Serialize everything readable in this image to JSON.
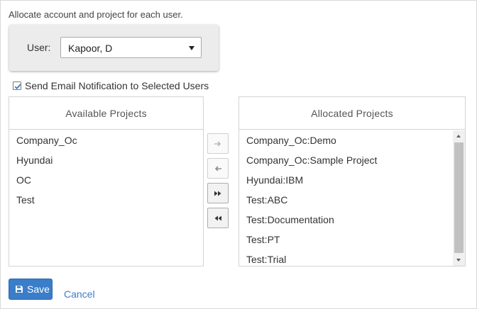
{
  "instructions": "Allocate account and project for each user.",
  "user": {
    "label": "User:",
    "selected": "Kapoor, D"
  },
  "notify": {
    "label": "Send Email Notification to Selected Users",
    "checked": true
  },
  "available": {
    "header": "Available Projects",
    "items": [
      "Company_Oc",
      "Hyundai",
      "OC",
      "Test"
    ]
  },
  "allocated": {
    "header": "Allocated Projects",
    "items": [
      "Company_Oc:Demo",
      "Company_Oc:Sample Project",
      "Hyundai:IBM",
      "Test:ABC",
      "Test:Documentation",
      "Test:PT",
      "Test:Trial"
    ]
  },
  "move_buttons": {
    "add": "arrow-right-icon",
    "remove": "arrow-left-icon",
    "add_all": "double-arrow-right-icon",
    "remove_all": "double-arrow-left-icon"
  },
  "actions": {
    "save_label": "Save",
    "cancel_label": "Cancel",
    "save_icon": "floppy-disk-icon"
  },
  "colors": {
    "accent": "#3a7dc9",
    "panel_bg": "#ececec",
    "border": "#d4d4d4"
  }
}
